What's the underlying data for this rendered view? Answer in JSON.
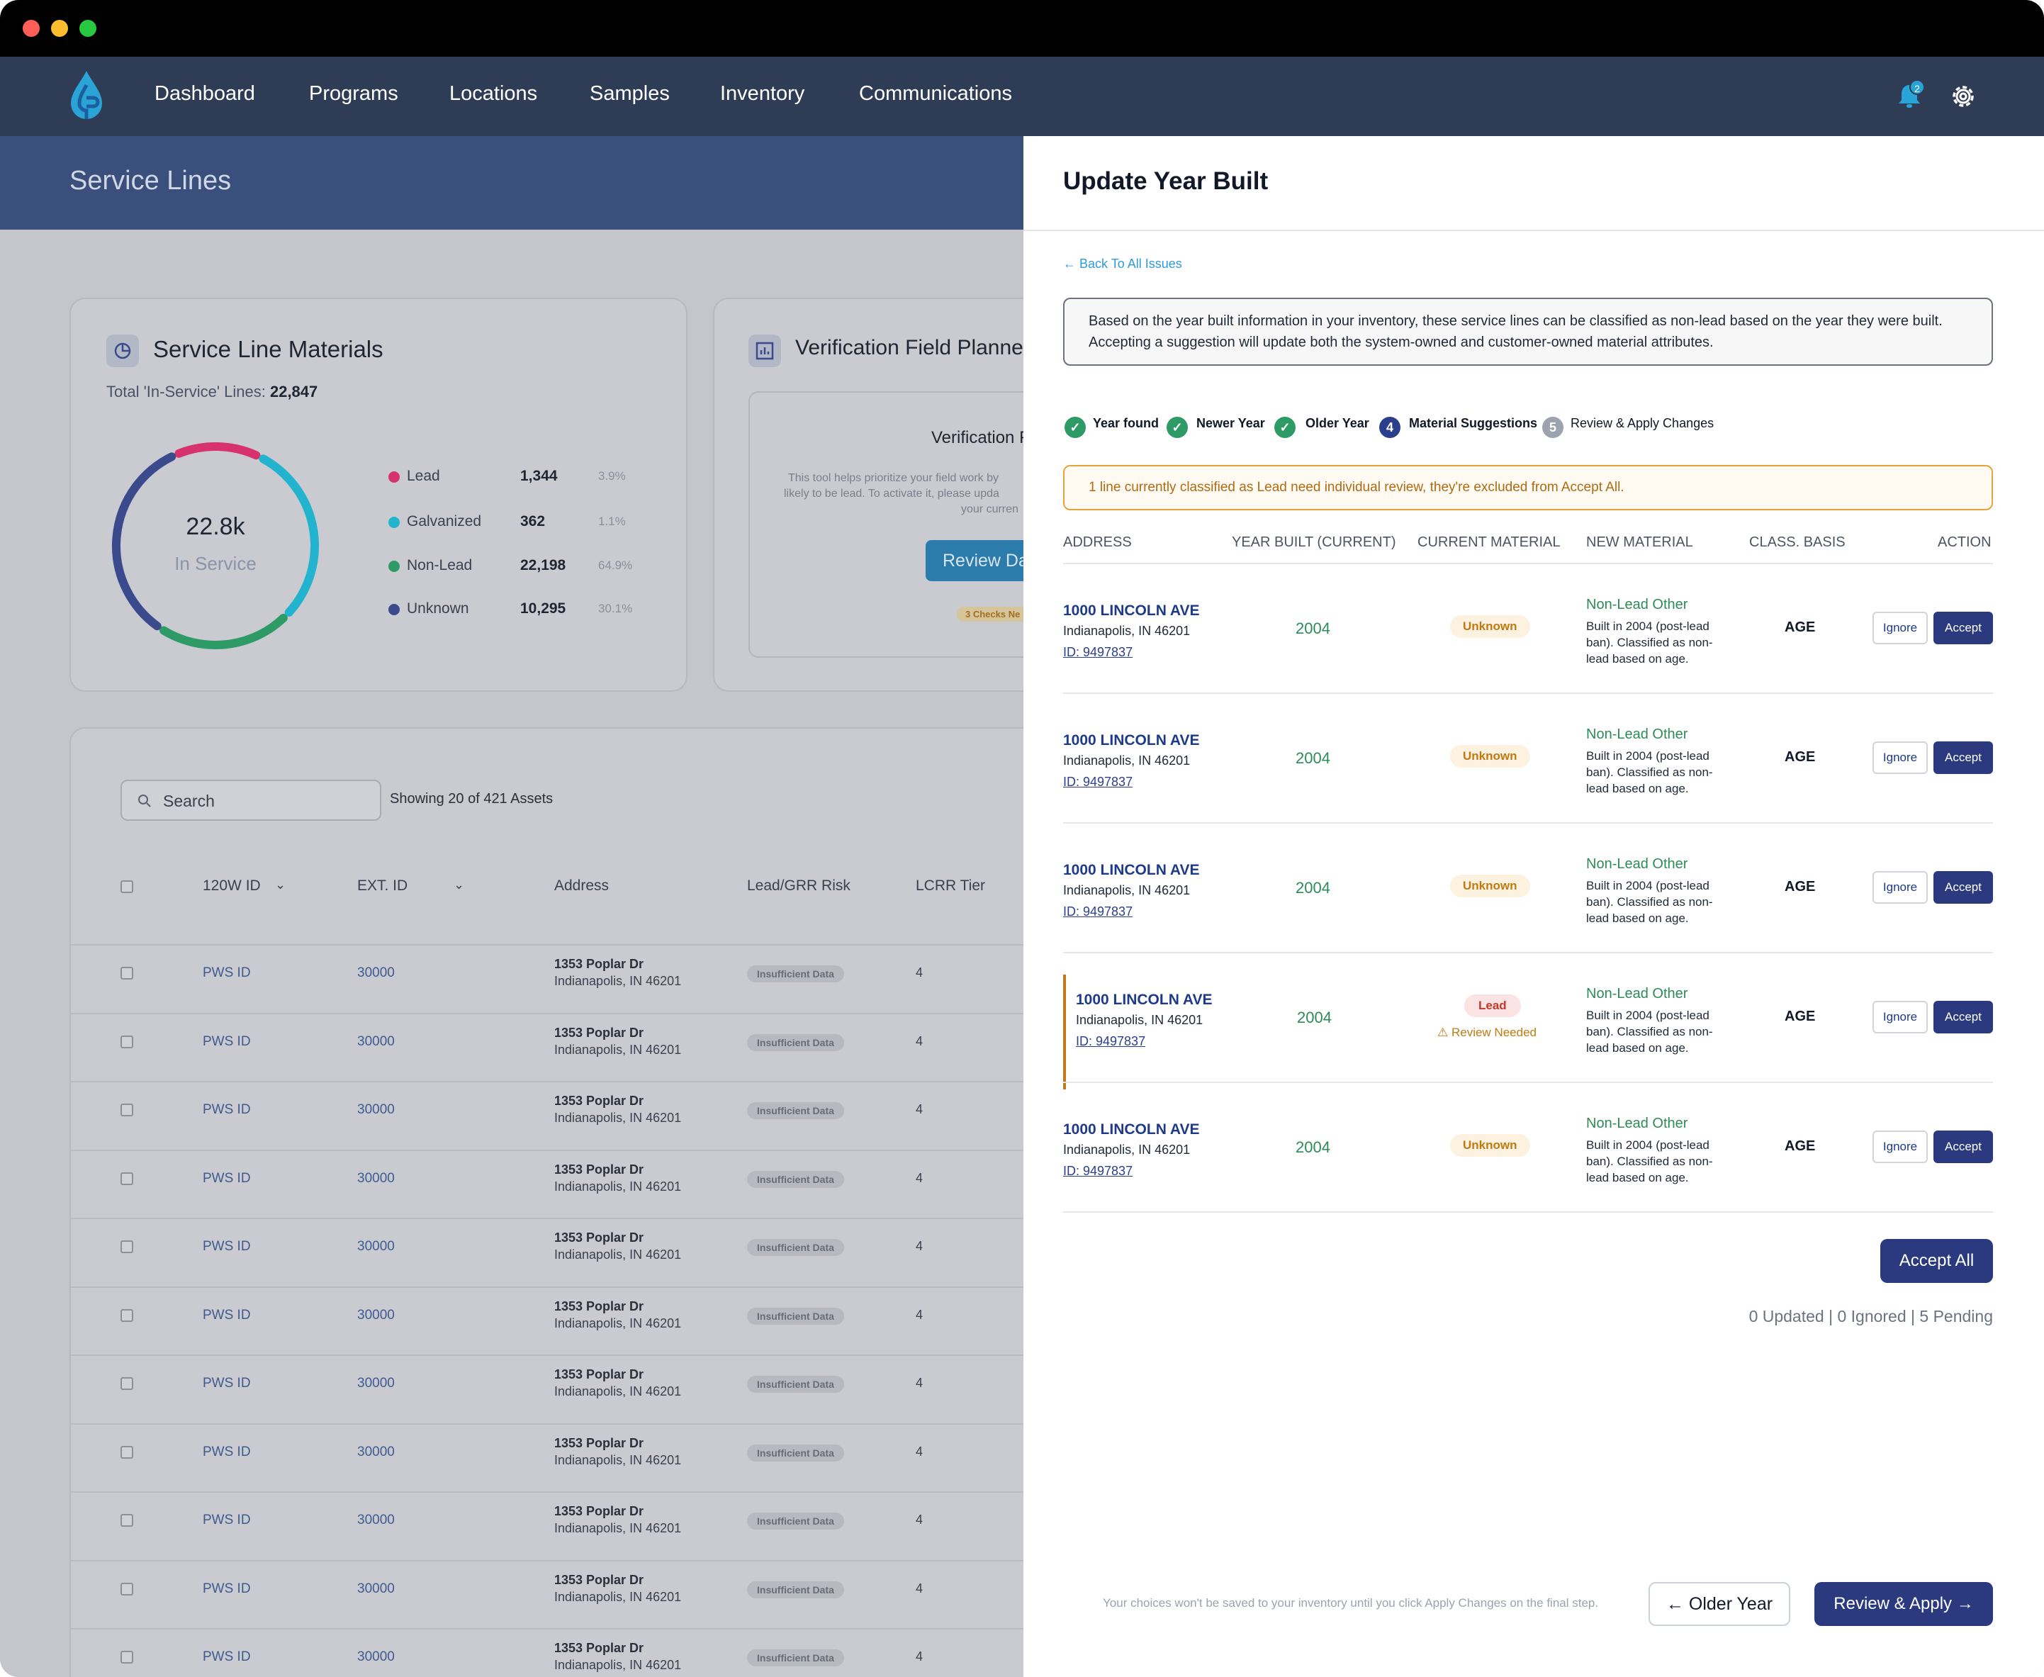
{
  "nav": {
    "items": [
      "Dashboard",
      "Programs",
      "Locations",
      "Samples",
      "Inventory",
      "Communications"
    ],
    "notification_count": "2"
  },
  "page": {
    "title": "Service Lines"
  },
  "materials_card": {
    "title": "Service Line Materials",
    "total_label": "Total 'In-Service' Lines:",
    "total_value": "22,847",
    "donut_value": "22.8k",
    "donut_label": "In Service",
    "legend": [
      {
        "label": "Lead",
        "count": "1,344",
        "pct": "3.9%",
        "color": "#d6336c",
        "value": 3.9
      },
      {
        "label": "Galvanized",
        "count": "362",
        "pct": "1.1%",
        "color": "#22b3cf",
        "value": 1.1
      },
      {
        "label": "Non-Lead",
        "count": "22,198",
        "pct": "64.9%",
        "color": "#2e9a66",
        "value": 64.9
      },
      {
        "label": "Unknown",
        "count": "10,295",
        "pct": "30.1%",
        "color": "#3b4a8c",
        "value": 30.1
      }
    ]
  },
  "planner_card": {
    "title": "Verification Field Planner",
    "inner_title": "Verification F",
    "inner_text_1": "This tool helps prioritize your field work by",
    "inner_text_2": "likely to be lead. To activate it, please upda",
    "inner_text_3": "your curren",
    "button": "Review Da",
    "badge": "3 Checks Ne"
  },
  "table": {
    "search_placeholder": "Search",
    "showing": "Showing 20 of 421 Assets",
    "headers": [
      "120W ID",
      "EXT. ID",
      "Address",
      "Lead/GRR Risk",
      "LCRR Tier"
    ],
    "row": {
      "pws": "PWS ID",
      "ext": "30000",
      "addr1": "1353 Poplar Dr",
      "addr2": "Indianapolis, IN 46201",
      "risk": "Insufficient Data",
      "tier": "4"
    },
    "last_row_addr": "1353 Poplar Dr"
  },
  "panel": {
    "title": "Update Year Built",
    "back": "Back To All Issues",
    "info": "Based on the year built information in your inventory, these service lines can be classified as non-lead based on the year they were built. Accepting a suggestion will update both the system-owned and customer-owned material attributes.",
    "steps": [
      {
        "label": "Year found",
        "state": "done",
        "num": ""
      },
      {
        "label": "Newer Year",
        "state": "done",
        "num": ""
      },
      {
        "label": "Older Year",
        "state": "done",
        "num": ""
      },
      {
        "label": "Material Suggestions",
        "state": "active",
        "num": "4"
      },
      {
        "label": "Review & Apply Changes",
        "state": "todo",
        "num": "5"
      }
    ],
    "warning": "1 line currently classified as Lead need individual review, they're excluded from Accept All.",
    "columns": [
      "ADDRESS",
      "YEAR BUILT (CURRENT)",
      "CURRENT MATERIAL",
      "NEW MATERIAL",
      "CLASS. BASIS",
      "ACTION"
    ],
    "rows": [
      {
        "address": "1000 LINCOLN AVE",
        "city": "Indianapolis, IN 46201",
        "id": "ID: 9497837",
        "year": "2004",
        "current": "Unknown",
        "new_title": "Non-Lead Other",
        "new_desc": "Built in 2004 (post-lead ban). Classified as non-lead based on age.",
        "basis": "AGE"
      },
      {
        "address": "1000 LINCOLN AVE",
        "city": "Indianapolis, IN 46201",
        "id": "ID: 9497837",
        "year": "2004",
        "current": "Unknown",
        "new_title": "Non-Lead Other",
        "new_desc": "Built in 2004 (post-lead ban). Classified as non-lead based on age.",
        "basis": "AGE"
      },
      {
        "address": "1000 LINCOLN AVE",
        "city": "Indianapolis, IN 46201",
        "id": "ID: 9497837",
        "year": "2004",
        "current": "Unknown",
        "new_title": "Non-Lead Other",
        "new_desc": "Built in 2004 (post-lead ban). Classified as non-lead based on age.",
        "basis": "AGE"
      },
      {
        "address": "1000 LINCOLN AVE",
        "city": "Indianapolis, IN 46201",
        "id": "ID: 9497837",
        "year": "2004",
        "current": "Lead",
        "review": "Review Needed",
        "new_title": "Non-Lead Other",
        "new_desc": "Built in 2004 (post-lead ban). Classified as non-lead based on age.",
        "basis": "AGE"
      },
      {
        "address": "1000 LINCOLN AVE",
        "city": "Indianapolis, IN 46201",
        "id": "ID: 9497837",
        "year": "2004",
        "current": "Unknown",
        "new_title": "Non-Lead Other",
        "new_desc": "Built in 2004 (post-lead ban). Classified as non-lead based on age.",
        "basis": "AGE"
      }
    ],
    "ignore_label": "Ignore",
    "accept_label": "Accept",
    "accept_all": "Accept All",
    "counts": "0 Updated | 0 Ignored | 5 Pending",
    "footer_note": "Your choices won't be saved to your inventory until you click Apply Changes on the final step.",
    "older_year": "Older Year",
    "review_apply": "Review & Apply"
  }
}
